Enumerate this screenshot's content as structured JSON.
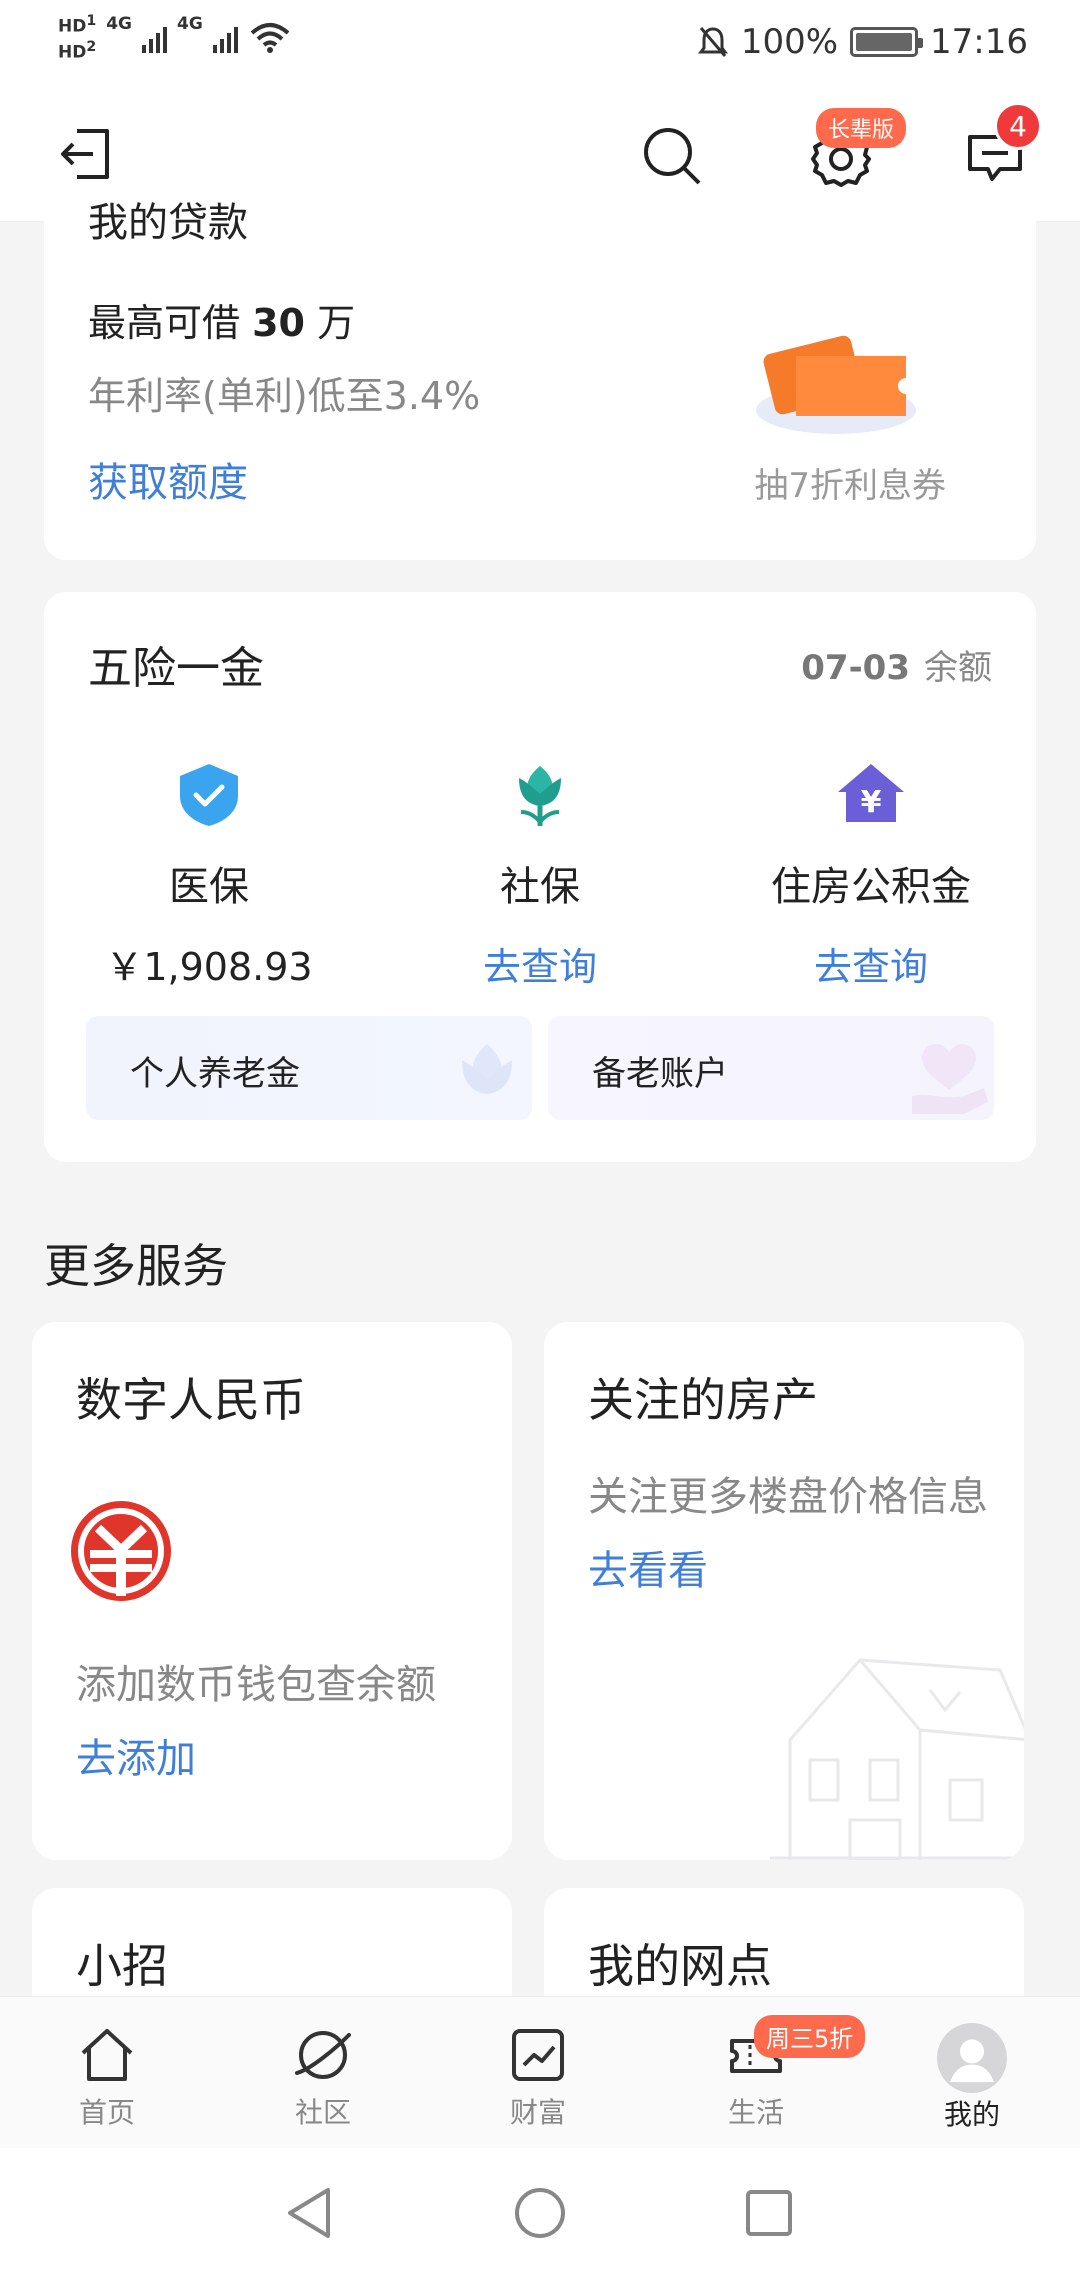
{
  "status_bar": {
    "hd1": "HD",
    "hd1_sub": "1",
    "hd2": "HD",
    "hd2_sub": "2",
    "net1": "4G",
    "net2": "4G",
    "battery": "100%",
    "battery_level": 1.0,
    "time": "17:16"
  },
  "top_nav": {
    "elder_badge": "长辈版",
    "message_count": "4"
  },
  "loan": {
    "partial_title": "我的贷款",
    "max_prefix": "最高可借",
    "max_amount": "30",
    "max_unit": "万",
    "rate": "年利率(单利)低至3.4%",
    "link": "获取额度",
    "coupon": "抽7折利息券"
  },
  "insurance": {
    "title": "五险一金",
    "date": "07-03",
    "balance_label": "余额",
    "items": [
      {
        "label": "医保",
        "value": "￥1,908.93"
      },
      {
        "label": "社保",
        "value": "去查询"
      },
      {
        "label": "住房公积金",
        "value": "去查询"
      }
    ],
    "pension": "个人养老金",
    "elder_account": "备老账户"
  },
  "more_services": {
    "title": "更多服务",
    "cards": [
      {
        "title": "数字人民币",
        "desc": "添加数币钱包查余额",
        "link": "去添加"
      },
      {
        "title": "关注的房产",
        "desc": "关注更多楼盘价格信息",
        "link": "去看看"
      },
      {
        "title": "小招"
      },
      {
        "title": "我的网点"
      }
    ]
  },
  "tabbar": {
    "tabs": [
      {
        "label": "首页"
      },
      {
        "label": "社区"
      },
      {
        "label": "财富"
      },
      {
        "label": "生活",
        "badge": "周三5折"
      },
      {
        "label": "我的"
      }
    ]
  },
  "colors": {
    "link": "#3f7fd9",
    "badge": "#ff6a4d",
    "alert": "#f0393a",
    "ecny_red": "#e0352b"
  }
}
